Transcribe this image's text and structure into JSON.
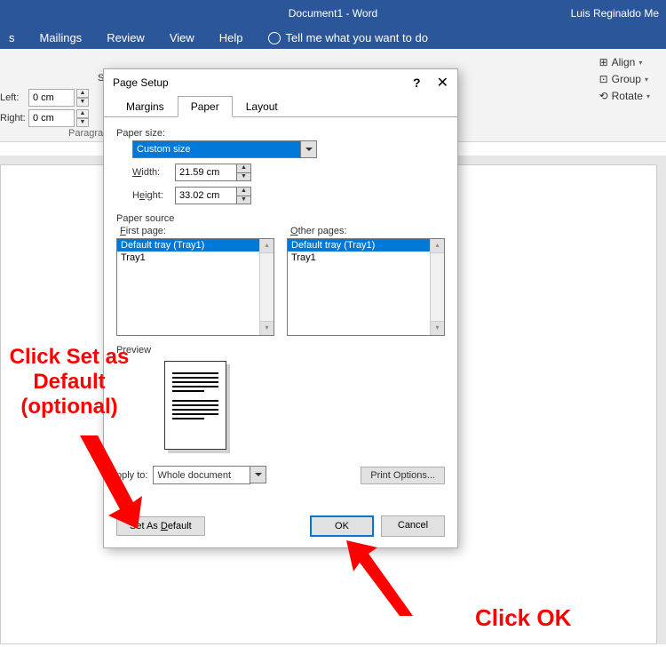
{
  "title_bar": {
    "document": "Document1 - Word",
    "user": "Luis Reginaldo Me"
  },
  "ribbon_tabs": {
    "t1": "s",
    "t2": "Mailings",
    "t3": "Review",
    "t4": "View",
    "t5": "Help",
    "tell_me": "Tell me what you want to do"
  },
  "ribbon_right": {
    "align": "Align",
    "group": "Group",
    "rotate": "Rotate"
  },
  "indent": {
    "left_label": "Left:",
    "left_value": "0 cm",
    "right_label": "Right:",
    "right_value": "0 cm",
    "group": "Paragra",
    "s": "S"
  },
  "dialog": {
    "title": "Page Setup",
    "help": "?",
    "close": "✕",
    "tabs": {
      "margins": "Margins",
      "paper": "Paper",
      "layout": "Layout"
    },
    "paper_size_label": "Paper size:",
    "paper_size_value": "Custom size",
    "width_label_pre": "W",
    "width_label_u": "i",
    "width_label_post": "dth:",
    "width_value": "21.59 cm",
    "height_label_pre": "H",
    "height_label_u": "e",
    "height_label_post": "ight:",
    "height_value": "33.02 cm",
    "paper_source_label": "Paper source",
    "first_page_label_u": "F",
    "first_page_label_post": "irst page:",
    "other_pages_label_u": "O",
    "other_pages_label_post": "ther pages:",
    "first_options": {
      "opt1": "Default tray (Tray1)",
      "opt2": "Tray1"
    },
    "other_options": {
      "opt1": "Default tray (Tray1)",
      "opt2": "Tray1"
    },
    "preview_label": "Preview",
    "apply_to_label": "pply to:",
    "apply_to_value": "Whole document",
    "print_options": "Print Options...",
    "set_default_pre": "Set As ",
    "set_default_u": "D",
    "set_default_post": "efault",
    "ok": "OK",
    "cancel": "Cancel"
  },
  "annotations": {
    "a1": "Click Set as Default (optional)",
    "a2": "Click OK"
  }
}
